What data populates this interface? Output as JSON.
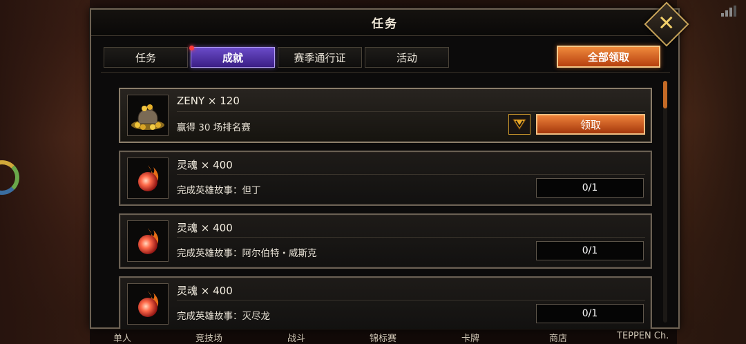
{
  "panel": {
    "title": "任务",
    "close_label": "✕"
  },
  "tabs": [
    {
      "label": "任务",
      "active": false
    },
    {
      "label": "成就",
      "active": true
    },
    {
      "label": "赛季通行证",
      "active": false
    },
    {
      "label": "活动",
      "active": false
    }
  ],
  "claim_all_label": "全部领取",
  "items": [
    {
      "reward": "ZENY  × 120",
      "description": "赢得 30 场排名赛",
      "action": "claim",
      "button_label": "领取",
      "icon": "gold-coin-bag-icon"
    },
    {
      "reward": "灵魂  × 400",
      "description": "完成英雄故事：但丁",
      "action": "progress",
      "progress": "0/1",
      "icon": "soul-orb-icon"
    },
    {
      "reward": "灵魂  × 400",
      "description": "完成英雄故事：阿尔伯特・威斯克",
      "action": "progress",
      "progress": "0/1",
      "icon": "soul-orb-icon"
    },
    {
      "reward": "灵魂  × 400",
      "description": "完成英雄故事：灭尽龙",
      "action": "progress",
      "progress": "0/1",
      "icon": "soul-orb-icon"
    }
  ],
  "bottom_nav": [
    "单人",
    "竞技场",
    "战斗",
    "锦标赛",
    "卡牌",
    "商店",
    "TEPPEN Ch."
  ],
  "colors": {
    "accent_orange": "#e0752e",
    "tab_active_purple": "#5a3ab8",
    "panel_border": "#6e6253"
  }
}
